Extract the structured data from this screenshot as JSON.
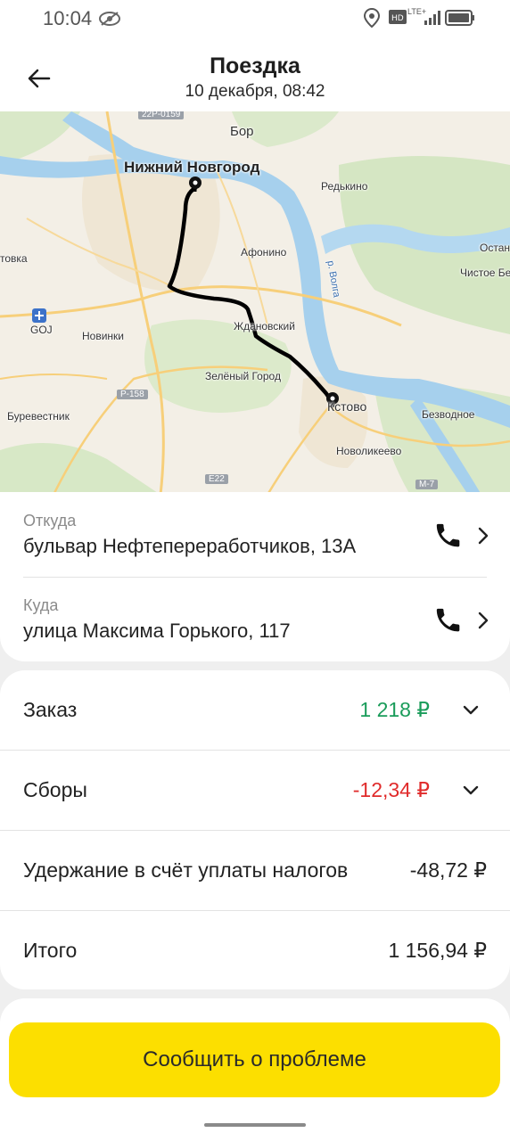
{
  "status_bar": {
    "time": "10:04",
    "network": "LTE+"
  },
  "header": {
    "title": "Поездка",
    "subtitle": "10 декабря, 08:42"
  },
  "map": {
    "labels": {
      "nn": "Нижний Новгород",
      "bor": "Бор",
      "redkino": "Редькино",
      "afonino": "Афонино",
      "zhdanovsky": "Ждановский",
      "zeleny": "Зелёный Город",
      "novinki": "Новинки",
      "kstovo": "Кстово",
      "burevestnik": "Буревестник",
      "bezvodnoe": "Безводное",
      "novolikeevo": "Новоликеево",
      "chistoe": "Чистое Бе",
      "ostan": "Остан",
      "tovka": "товка",
      "goj": "GOJ",
      "volga": "р. Волга",
      "r158": "Р-158",
      "e22": "E22",
      "m7": "M-7",
      "r22p": "22Р-0159"
    }
  },
  "addresses": {
    "from": {
      "label": "Откуда",
      "value": "бульвар Нефтепереработчиков, 13А"
    },
    "to": {
      "label": "Куда",
      "value": "улица Максима Горького, 117"
    }
  },
  "finance": {
    "order": {
      "label": "Заказ",
      "amount": "1 218 ₽",
      "color": "#1a9c5a"
    },
    "fees": {
      "label": "Сборы",
      "amount": "-12,34 ₽",
      "color": "#e02b2b"
    },
    "tax": {
      "label": "Удержание в счёт уплаты налогов",
      "amount": "-48,72 ₽"
    },
    "total": {
      "label": "Итого",
      "amount": "1 156,94 ₽"
    }
  },
  "actions": {
    "report": "Сообщить о проблеме"
  },
  "colors": {
    "accent_yellow": "#fcdf00",
    "water": "#a6d0ed",
    "route": "#000000"
  }
}
